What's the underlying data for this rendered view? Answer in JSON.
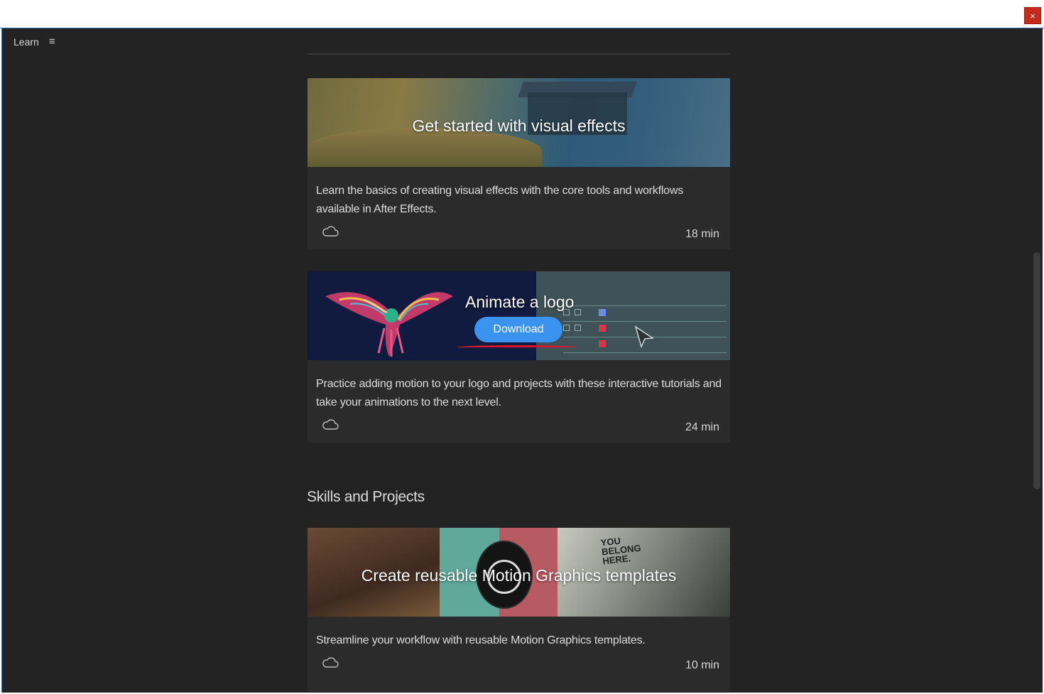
{
  "window": {
    "close_label": "×"
  },
  "panel": {
    "title": "Learn",
    "menu_glyph": "≡"
  },
  "cards": [
    {
      "banner_title": "Get started with visual effects",
      "description": "Learn the basics of creating visual effects with the core tools and workflows available in After Effects.",
      "duration": "18 min"
    },
    {
      "banner_title": "Animate a logo",
      "button_label": "Download",
      "description": "Practice adding motion to your logo and projects with these interactive tutorials and take your animations to the next level.",
      "duration": "24 min"
    },
    {
      "banner_title": "Create reusable Motion Graphics templates",
      "description": "Streamline your workflow with reusable Motion Graphics templates.",
      "duration": "10 min",
      "banner_sign": "YOU BELONG HERE."
    }
  ],
  "sections": {
    "skills_title": "Skills and Projects"
  },
  "colors": {
    "background": "#232323",
    "card": "#2b2b2b",
    "accent_button": "#3b93f0",
    "close": "#c42b1c"
  }
}
